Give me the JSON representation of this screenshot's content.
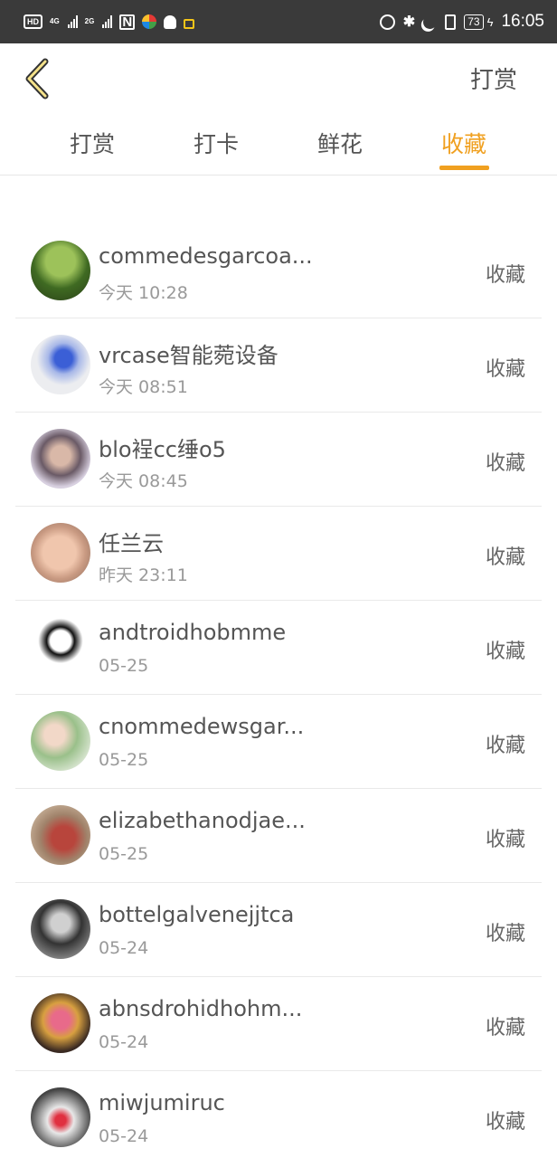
{
  "status_bar": {
    "hd": "HD",
    "net1": "4G",
    "net2": "2G",
    "battery": "73",
    "time": "16:05"
  },
  "header": {
    "action_label": "打赏"
  },
  "tabs": [
    {
      "label": "打赏",
      "active": false
    },
    {
      "label": "打卡",
      "active": false
    },
    {
      "label": "鲜花",
      "active": false
    },
    {
      "label": "收藏",
      "active": true
    }
  ],
  "colors": {
    "accent": "#f0a020",
    "status_bar": "#3a3a3a",
    "text": "#555555",
    "subtext": "#999999"
  },
  "list": [
    {
      "name": "commedesgarcoa...",
      "time": "今天 10:28",
      "action": "收藏"
    },
    {
      "name": "vrcase智能菀设备",
      "time": "今天 08:51",
      "action": "收藏"
    },
    {
      "name": "blo裎cc缍o5",
      "time": "今天 08:45",
      "action": "收藏"
    },
    {
      "name": "任兰云",
      "time": "昨天 23:11",
      "action": "收藏"
    },
    {
      "name": "andtroidhobmme",
      "time": "05-25",
      "action": "收藏"
    },
    {
      "name": "cnommedewsgar...",
      "time": "05-25",
      "action": "收藏"
    },
    {
      "name": "elizabethanodjae...",
      "time": "05-25",
      "action": "收藏"
    },
    {
      "name": "bottelgalvenejjtca",
      "time": "05-24",
      "action": "收藏"
    },
    {
      "name": "abnsdrohidhohm...",
      "time": "05-24",
      "action": "收藏"
    },
    {
      "name": "miwjumiruc",
      "time": "05-24",
      "action": "收藏"
    }
  ]
}
